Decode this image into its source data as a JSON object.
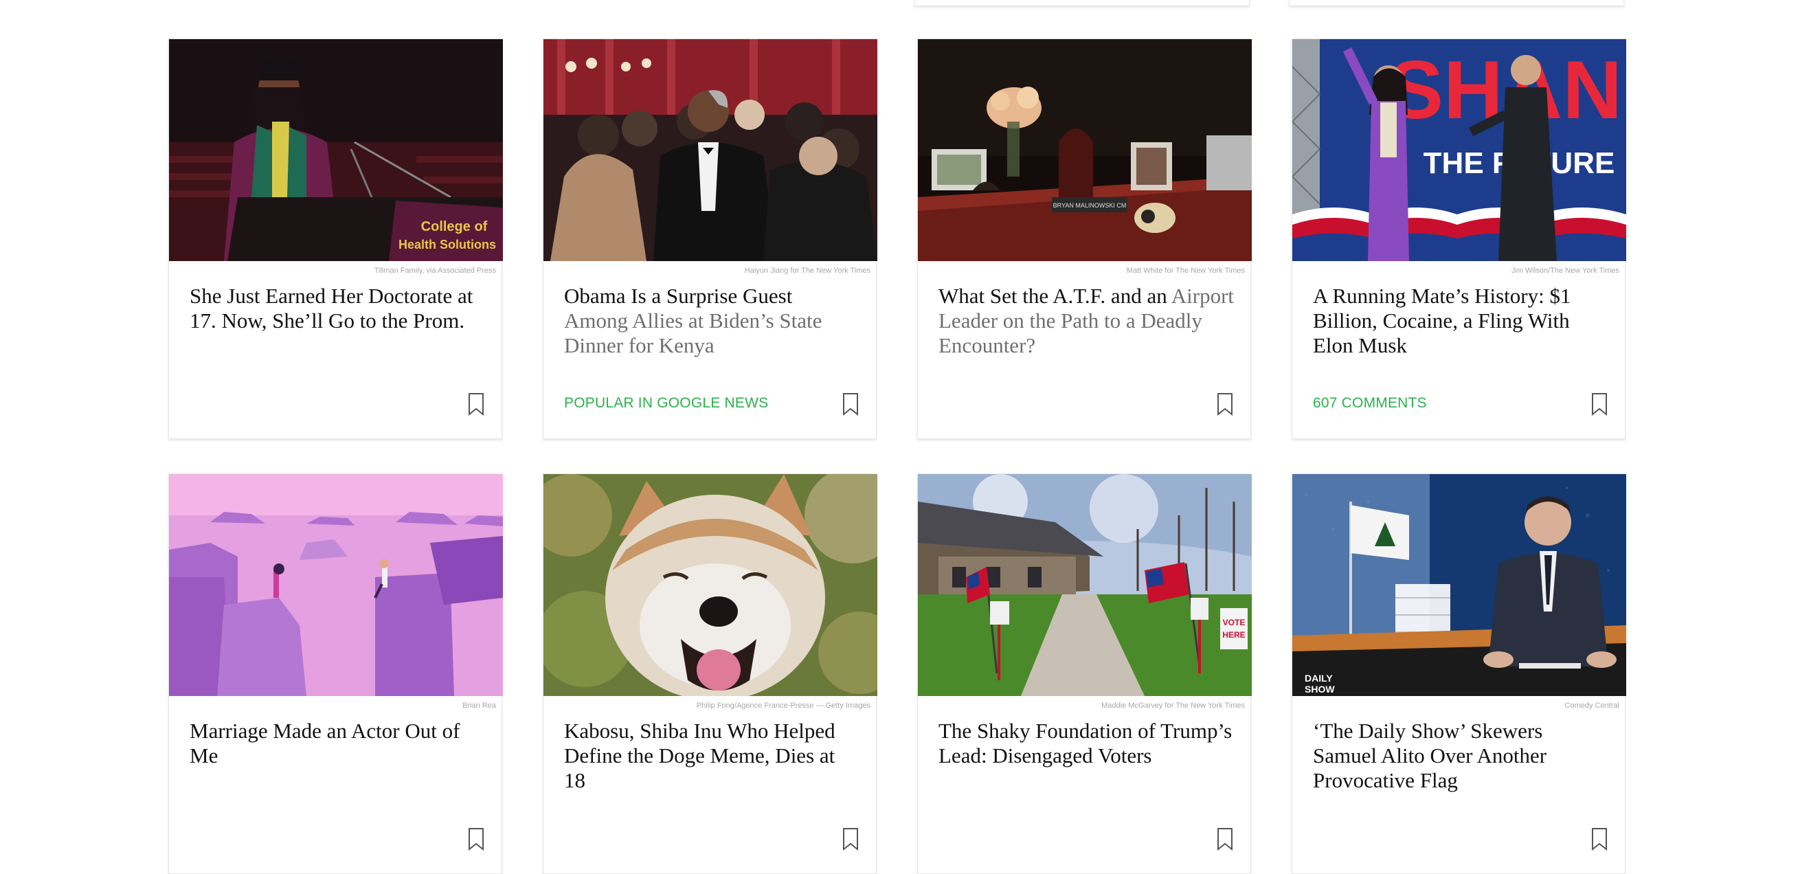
{
  "colors": {
    "headline": "#121212",
    "headline_visited": "#6f6f6f",
    "tag": "#2bb24c",
    "credit": "#a7a7a7",
    "card_border": "#e6e6e6"
  },
  "bookmark_icon": "bookmark-icon",
  "cards": [
    {
      "credit": "Tillman Family, via Associated Press",
      "headline_lead": "",
      "headline": "She Just Earned Her Doctorate at 17. Now, She’ll Go to the Prom.",
      "image_text": [
        "College of",
        "Health Solutions"
      ],
      "tag": ""
    },
    {
      "credit": "Haiyun Jiang for The New York Times",
      "headline_lead": "Obama Is a Surprise Guest ",
      "headline": "Among Allies at Biden’s State Dinner for Kenya",
      "tag": "POPULAR IN GOOGLE NEWS"
    },
    {
      "credit": "Matt White for The New York Times",
      "headline_lead": "What Set the A.T.F. and an ",
      "headline": "Airport Leader on the Path to a Deadly Encounter?",
      "image_text": [
        "BRYAN MALINOWSKI CM"
      ],
      "tag": ""
    },
    {
      "credit": "Jim Wilson/The New York Times",
      "headline_lead": "",
      "headline": "A Running Mate’s History: $1 Billion, Cocaine, a Fling With Elon Musk",
      "image_text": [
        "SHAN",
        "THE FUTURE"
      ],
      "tag": "607 COMMENTS"
    },
    {
      "credit": "Brian Rea",
      "headline_lead": "",
      "headline": "Marriage Made an Actor Out of Me",
      "tag": ""
    },
    {
      "credit": "Philip Fong/Agence France-Presse — Getty Images",
      "headline_lead": "",
      "headline": "Kabosu, Shiba Inu Who Helped Define the Doge Meme, Dies at 18",
      "tag": ""
    },
    {
      "credit": "Maddie McGarvey for The New York Times",
      "headline_lead": "",
      "headline": "The Shaky Foundation of Trump’s Lead: Disengaged Voters",
      "image_text": [
        "VOTE",
        "HERE"
      ],
      "tag": ""
    },
    {
      "credit": "Comedy Central",
      "headline_lead": "",
      "headline": "‘The Daily Show’ Skewers Samuel Alito Over Another Provocative Flag",
      "image_text": [
        "DAILY",
        "SHOW"
      ],
      "tag": ""
    }
  ]
}
